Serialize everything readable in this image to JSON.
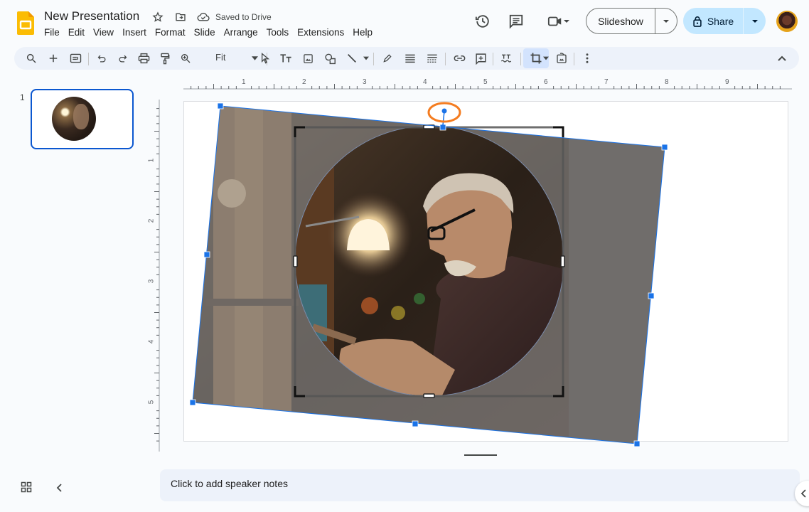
{
  "app": {
    "title": "New Presentation",
    "save_status": "Saved to Drive",
    "brand_color": "#fbbc04",
    "accent_color": "#0b57d0"
  },
  "menu": [
    "File",
    "Edit",
    "View",
    "Insert",
    "Format",
    "Slide",
    "Arrange",
    "Tools",
    "Extensions",
    "Help"
  ],
  "header_actions": {
    "history_icon": "history-icon",
    "comments_icon": "comments-icon",
    "meet_icon": "video-camera-icon",
    "slideshow_label": "Slideshow",
    "share_label": "Share",
    "share_color": "#c2e7ff"
  },
  "toolbar": {
    "items": [
      "search-menus",
      "new-slide",
      "layout",
      "undo",
      "redo",
      "print",
      "paint-format",
      "zoom",
      "select",
      "text-box",
      "image",
      "shape",
      "line",
      "border-color",
      "border-weight",
      "border-dash",
      "insert-link",
      "add-comment",
      "alt-text",
      "crop",
      "reset-image",
      "more"
    ],
    "zoom_value": "Fit",
    "active_tool": "crop"
  },
  "filmstrip": {
    "slides": [
      {
        "number": "1",
        "selected": true
      }
    ]
  },
  "rulers": {
    "horizontal_labels": [
      "1",
      "2",
      "3",
      "4",
      "5",
      "6",
      "7",
      "8",
      "9"
    ],
    "vertical_labels": [
      "1",
      "2",
      "3",
      "4",
      "5"
    ]
  },
  "canvas": {
    "mode": "crop-image",
    "mask_shape": "ellipse",
    "rotation_handle_highlight_color": "#f47c20",
    "selection_color": "#1a73e8"
  },
  "notes": {
    "placeholder": "Click to add speaker notes"
  }
}
